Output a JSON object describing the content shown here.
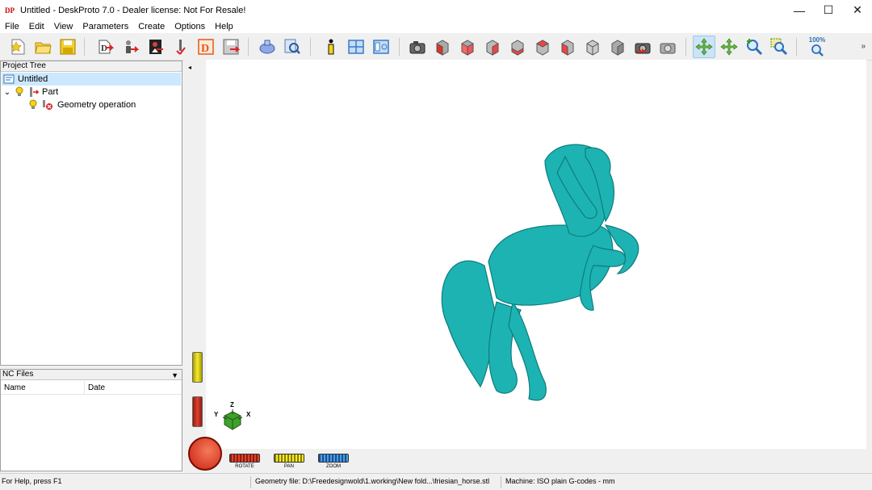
{
  "window": {
    "app_icon": "DP",
    "title": "Untitled - DeskProto 7.0 - Dealer license: Not For Resale!",
    "minimize": "—",
    "maximize": "☐",
    "close": "✕"
  },
  "menu": [
    "File",
    "Edit",
    "View",
    "Parameters",
    "Create",
    "Options",
    "Help"
  ],
  "toolbar": {
    "zoom_percent": "100%",
    "more": "»",
    "buttons": [
      "new-file-icon",
      "open-folder-icon",
      "save-disk-icon",
      "geometry-import-icon",
      "vector-import-icon",
      "bitmap-import-icon",
      "tool-icon",
      "drawing-icon",
      "save-nc-icon",
      "simulation-icon",
      "preview-icon",
      "info-icon",
      "window-layout-icon",
      "panel-view-icon",
      "camera-icon",
      "view-front-icon",
      "view-right-icon",
      "view-back-icon",
      "view-left-icon",
      "view-top-icon",
      "view-bottom-icon",
      "view-iso-icon",
      "view-side-icon",
      "camera-refresh-icon",
      "camera-settings-icon",
      "rotate-mode-icon",
      "pan-mode-icon",
      "zoom-mode-icon",
      "zoom-window-icon",
      "zoom-100-icon"
    ]
  },
  "project_tree": {
    "header": "Project Tree",
    "items": [
      {
        "label": "Untitled",
        "level": 0
      },
      {
        "label": "Part",
        "level": 1
      },
      {
        "label": "Geometry operation",
        "level": 2
      }
    ],
    "expander": "⌄"
  },
  "nc_files": {
    "header": "NC Files",
    "dropdown": "▼",
    "columns": [
      "Name",
      "Date"
    ]
  },
  "viewport": {
    "collapse_arrow": "◂",
    "axis": {
      "z": "Z",
      "y": "Y",
      "x": "X"
    },
    "model_color": "#1eb3b3",
    "wheels": [
      {
        "label": "ROTATE",
        "color": "#d43a2a"
      },
      {
        "label": "PAN",
        "color": "#e8e020"
      },
      {
        "label": "ZOOM",
        "color": "#3a8ed8"
      }
    ]
  },
  "statusbar": {
    "help": "For Help, press F1",
    "geometry_file": "Geometry file: D:\\Freedesignwold\\1.working\\New fold...\\friesian_horse.stl",
    "machine": "Machine: ISO plain G-codes - mm"
  }
}
